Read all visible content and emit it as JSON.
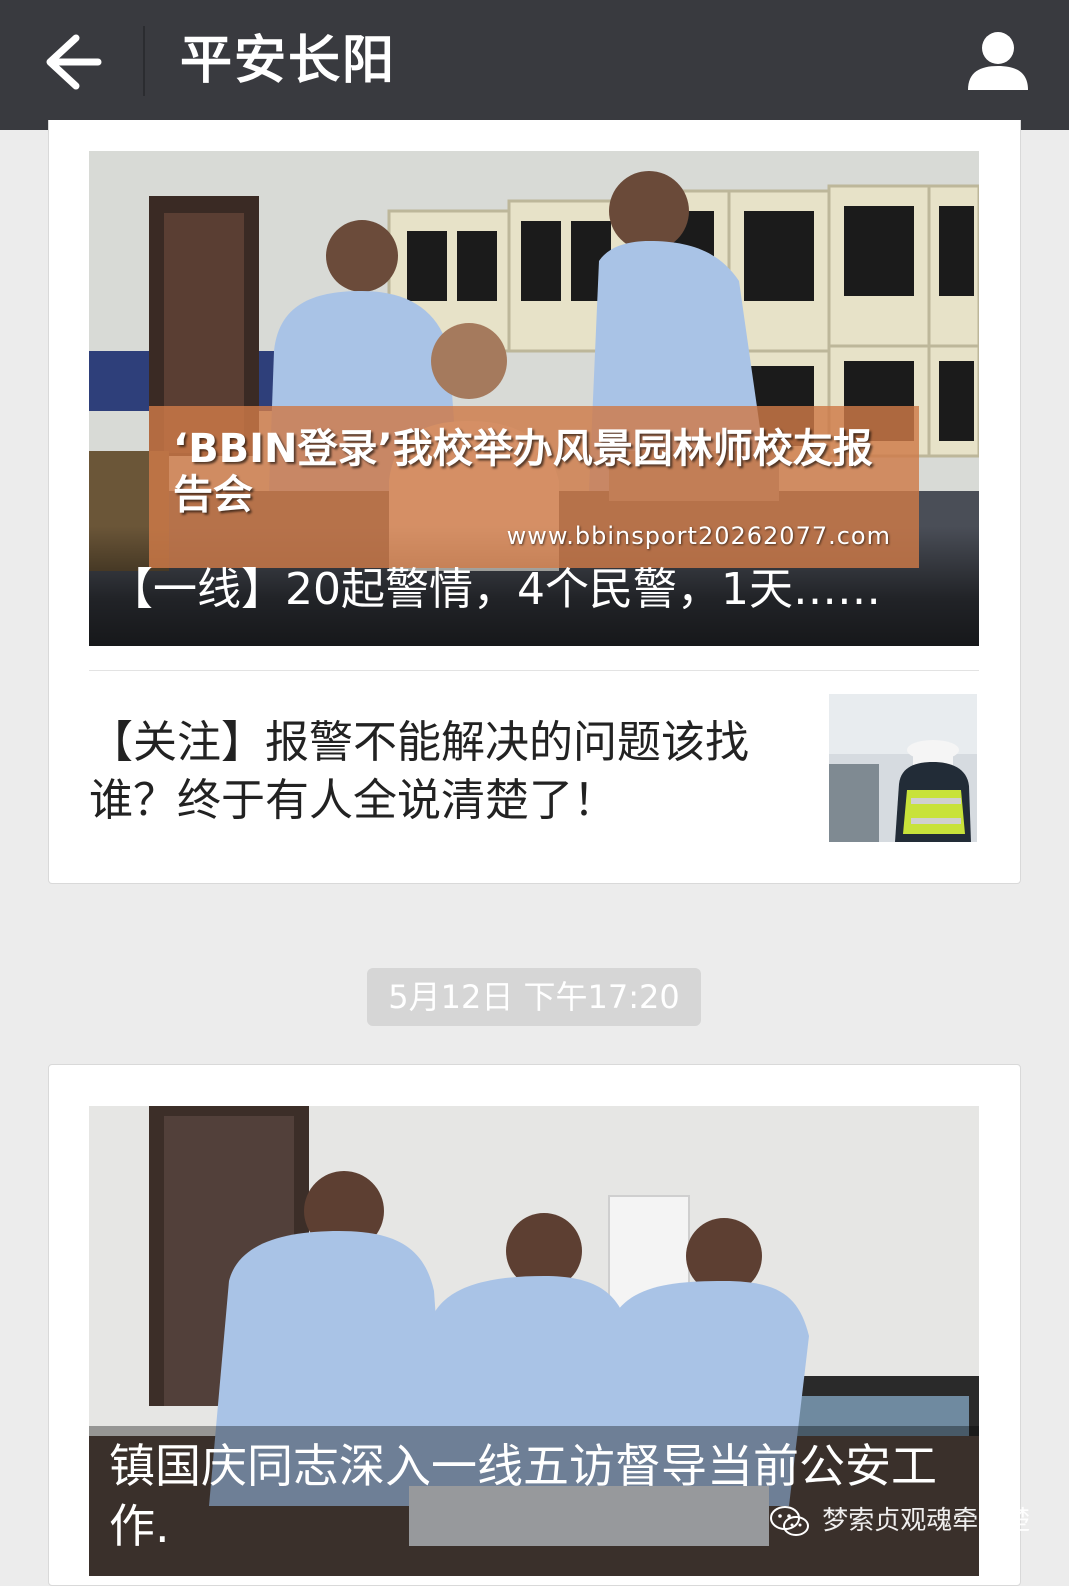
{
  "header": {
    "title": "平安长阳",
    "back_icon": "arrow-left-icon",
    "user_icon": "user-icon"
  },
  "card1": {
    "cover_title": "【一线】20起警情，4个民警，1天……",
    "promo_text": "‘BBIN登录’我校举办风景园林师校友报告会",
    "promo_url": "www.bbinsport20262077.com",
    "article_title": "【关注】报警不能解决的问题该找谁？终于有人全说清楚了！"
  },
  "timestamp": "5月12日 下午17:20",
  "card2": {
    "cover_title": "镇国庆同志深入一线五访督导当前公安工作."
  },
  "watermark": {
    "text": "梦索贞观魂牵荆楚",
    "icon": "wechat-icon"
  },
  "colors": {
    "topbar": "#393a3f",
    "background": "#ececec",
    "promo": "#ce7a48",
    "uniform": "#a9c3e6"
  }
}
